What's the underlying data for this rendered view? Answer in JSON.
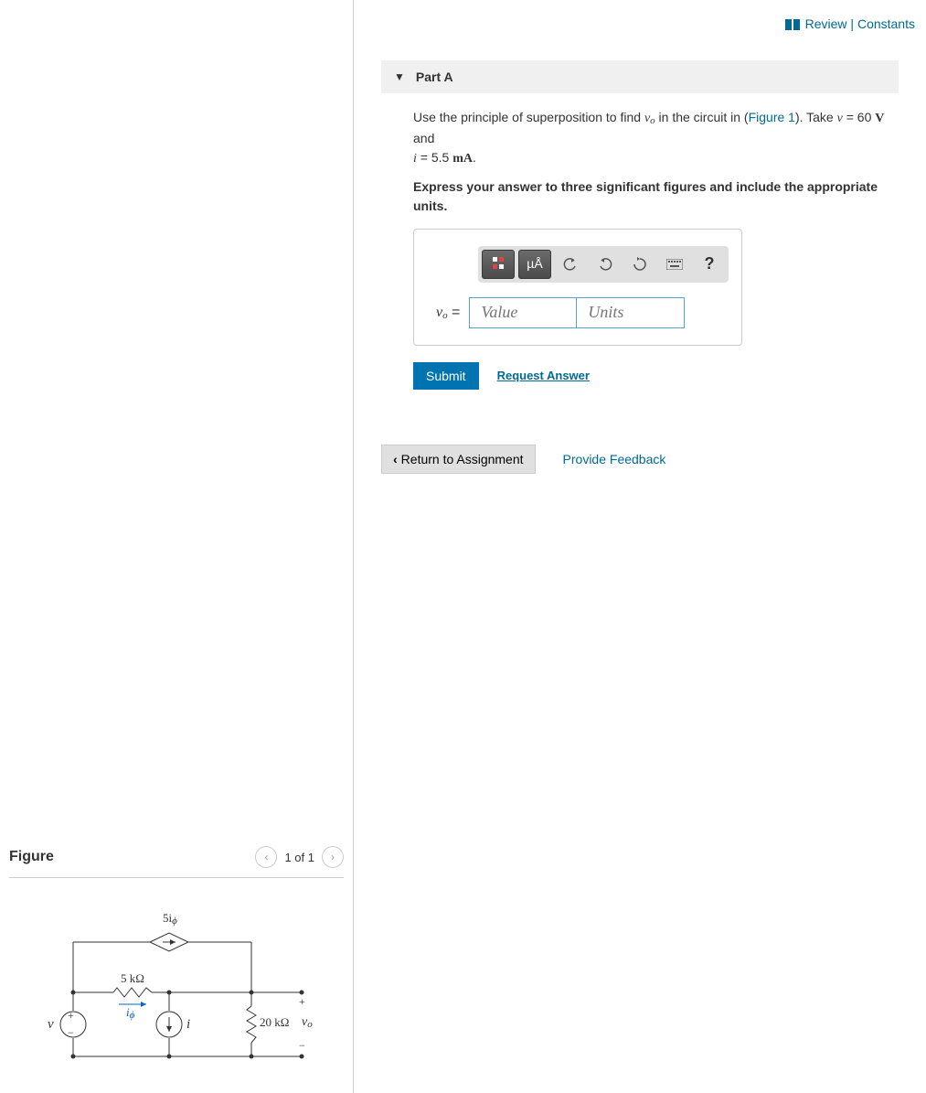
{
  "topLinks": {
    "review": "Review",
    "sep": " | ",
    "constants": "Constants"
  },
  "part": {
    "title": "Part A",
    "prompt1a": "Use the principle of superposition to find ",
    "prompt_vo": "v",
    "prompt_vo_sub": "o",
    "prompt1b": " in the circuit in (",
    "figlink": "Figure 1",
    "prompt1c": "). Take ",
    "v_eq": "v",
    "v_val": " = 60 ",
    "v_unit": "V",
    "and": " and ",
    "i_eq": "i",
    "i_val": " = 5.5 ",
    "i_unit": "mA",
    "period": ".",
    "instr": "Express your answer to three significant figures and include the appropriate units."
  },
  "toolbar": {
    "units_btn": "µÅ",
    "help": "?"
  },
  "answer": {
    "label_v": "v",
    "label_sub": "o",
    "label_eq": " =",
    "value_ph": "Value",
    "units_ph": "Units"
  },
  "submit": {
    "btn": "Submit",
    "request": "Request Answer"
  },
  "footer": {
    "return": "Return to Assignment",
    "feedback": "Provide Feedback"
  },
  "figure": {
    "title": "Figure",
    "pager": "1 of 1",
    "labels": {
      "dep_src": "5i",
      "dep_sub": "ϕ",
      "r1": "5 kΩ",
      "iq": "i",
      "iq_sub": "ϕ",
      "vsrc": "v",
      "isrc": "i",
      "r2": "20 kΩ",
      "vo": "v",
      "vo_sub": "o",
      "plus": "+",
      "minus": "−"
    }
  }
}
